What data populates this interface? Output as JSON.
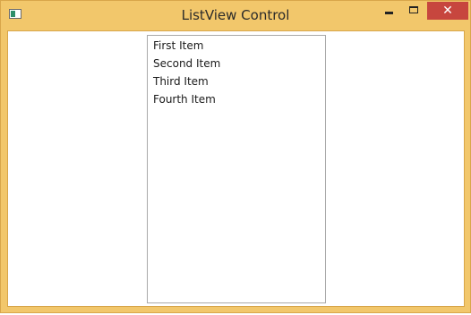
{
  "window": {
    "title": "ListView Control",
    "close_glyph": "✕",
    "icons": {
      "app": "window-app-icon",
      "minimize": "minimize-icon",
      "maximize": "maximize-icon",
      "close": "close-icon"
    },
    "colors": {
      "frame": "#f2c76b",
      "close_button": "#c7463e"
    }
  },
  "listview": {
    "items": [
      {
        "label": "First Item"
      },
      {
        "label": "Second Item"
      },
      {
        "label": "Third Item"
      },
      {
        "label": "Fourth Item"
      }
    ]
  }
}
